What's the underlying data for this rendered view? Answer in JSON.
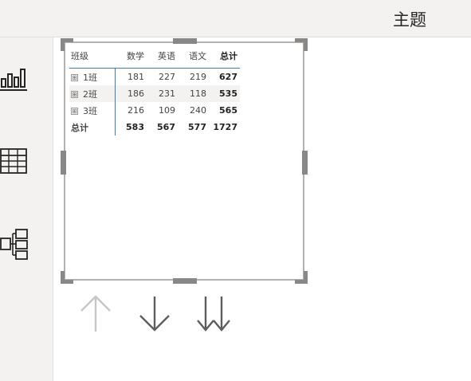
{
  "header": {
    "theme_label": "主题"
  },
  "sidebar": {
    "items": [
      {
        "name": "report-view",
        "icon": "bar-chart-icon"
      },
      {
        "name": "data-view",
        "icon": "table-grid-icon"
      },
      {
        "name": "model-view",
        "icon": "model-diagram-icon"
      }
    ]
  },
  "matrix": {
    "headers": [
      "班级",
      "数学",
      "英语",
      "语文",
      "总计"
    ],
    "rows": [
      {
        "label": "1班",
        "values": [
          "181",
          "227",
          "219"
        ],
        "total": "627"
      },
      {
        "label": "2班",
        "values": [
          "186",
          "231",
          "118"
        ],
        "total": "535"
      },
      {
        "label": "3班",
        "values": [
          "216",
          "109",
          "240"
        ],
        "total": "565"
      }
    ],
    "grand_total": {
      "label": "总计",
      "values": [
        "583",
        "567",
        "577"
      ],
      "total": "1727"
    },
    "expand_symbol": "⊞"
  },
  "drill_controls": {
    "up": "drill-up-arrow-icon",
    "down": "drill-down-arrow-icon",
    "expand_all": "expand-next-level-icon"
  },
  "colors": {
    "accent": "#3c7fb1",
    "chrome": "#f3f2f1",
    "handle": "#8a8886"
  }
}
